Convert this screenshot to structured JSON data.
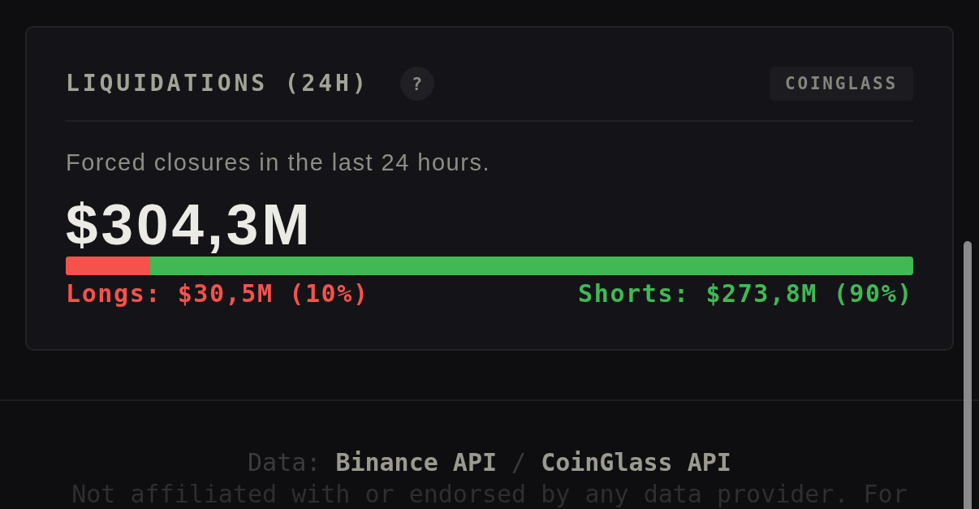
{
  "card": {
    "title": "LIQUIDATIONS (24H)",
    "help": "?",
    "source_badge": "COINGLASS",
    "description": "Forced closures in the last 24 hours.",
    "total": "$304,3M",
    "bar": {
      "level": 0.1
    },
    "longs": "Longs: $30,5M (10%)",
    "shorts": "Shorts: $273,8M (90%)"
  },
  "footer": {
    "data_label": "Data:",
    "sources": [
      "Binance API",
      "CoinGlass API"
    ],
    "separator": "/",
    "disclaimer": "Not affiliated with or endorsed by any data provider. For"
  }
}
